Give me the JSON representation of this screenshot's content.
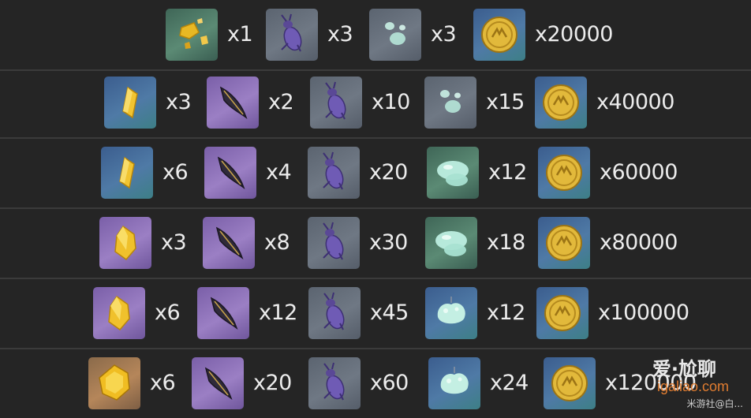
{
  "rows": [
    {
      "items": [
        {
          "icon": "gold-ore-chunks-icon",
          "qty": "x1"
        },
        {
          "icon": "purple-beetle-icon",
          "qty": "x3"
        },
        {
          "icon": "slime-drops-icon",
          "qty": "x3"
        },
        {
          "icon": "mora-coin-icon",
          "qty": "x20000"
        }
      ]
    },
    {
      "items": [
        {
          "icon": "gold-crystal-sliver-icon",
          "qty": "x3"
        },
        {
          "icon": "dark-feather-icon",
          "qty": "x2"
        },
        {
          "icon": "purple-beetle-icon",
          "qty": "x10"
        },
        {
          "icon": "slime-drops-icon",
          "qty": "x15"
        },
        {
          "icon": "mora-coin-icon",
          "qty": "x40000"
        }
      ]
    },
    {
      "items": [
        {
          "icon": "gold-crystal-sliver-icon",
          "qty": "x6"
        },
        {
          "icon": "dark-feather-icon",
          "qty": "x4"
        },
        {
          "icon": "purple-beetle-icon",
          "qty": "x20"
        },
        {
          "icon": "slime-condensate-icon",
          "qty": "x12"
        },
        {
          "icon": "mora-coin-icon",
          "qty": "x60000"
        }
      ]
    },
    {
      "items": [
        {
          "icon": "gold-crystal-fragment-icon",
          "qty": "x3"
        },
        {
          "icon": "dark-feather-icon",
          "qty": "x8"
        },
        {
          "icon": "purple-beetle-icon",
          "qty": "x30"
        },
        {
          "icon": "slime-condensate-icon",
          "qty": "x18"
        },
        {
          "icon": "mora-coin-icon",
          "qty": "x80000"
        }
      ]
    },
    {
      "items": [
        {
          "icon": "gold-crystal-fragment-icon",
          "qty": "x6"
        },
        {
          "icon": "dark-feather-icon",
          "qty": "x12"
        },
        {
          "icon": "purple-beetle-icon",
          "qty": "x45"
        },
        {
          "icon": "slime-concentrate-icon",
          "qty": "x12"
        },
        {
          "icon": "mora-coin-icon",
          "qty": "x100000"
        }
      ]
    },
    {
      "items": [
        {
          "icon": "gold-gemstone-icon",
          "qty": "x6"
        },
        {
          "icon": "dark-feather-icon",
          "qty": "x20"
        },
        {
          "icon": "purple-beetle-icon",
          "qty": "x60"
        },
        {
          "icon": "slime-concentrate-icon",
          "qty": "x24"
        },
        {
          "icon": "mora-coin-icon",
          "qty": "x120000"
        }
      ]
    }
  ],
  "watermark": {
    "logo_text": "爱·尬聊",
    "url_text": "igaliao.com",
    "credit_text": "米游社@白..."
  },
  "colors": {
    "page_background": "#252525",
    "row_divider": "#3b3b3b",
    "quantity_text": "#ececec",
    "watermark_orange": "#e07c30"
  }
}
